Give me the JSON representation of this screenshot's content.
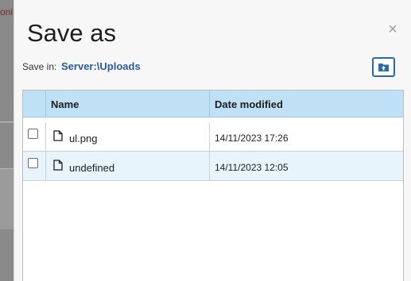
{
  "background": {
    "partial_text": "oni"
  },
  "dialog": {
    "title": "Save as",
    "close_glyph": "×",
    "save_in_label": "Save in:",
    "save_in_path": "Server:\\Uploads",
    "upload_icon": "folder-upload-icon"
  },
  "table": {
    "columns": [
      "",
      "Name",
      "Date modified"
    ],
    "rows": [
      {
        "name": "ul.png",
        "date": "14/11/2023 17:26",
        "checked": false
      },
      {
        "name": "undefined",
        "date": "14/11/2023 12:05",
        "checked": false
      }
    ]
  },
  "colors": {
    "header_bg": "#c0e0f5",
    "accent": "#2d6aa8",
    "alt_row_bg": "#e8f4fc"
  }
}
